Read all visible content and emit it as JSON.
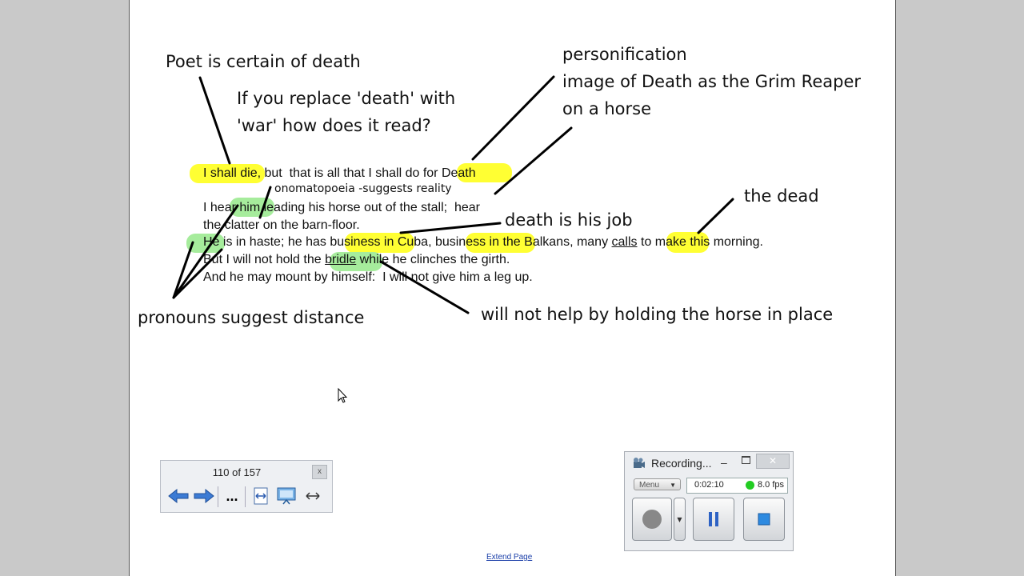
{
  "annotations": {
    "poet_certain": "Poet is certain of death",
    "replace_line1": "If you replace 'death' with",
    "replace_line2": "'war' how does it read?",
    "personification": "personification",
    "grim_line1": "image of Death as the Grim Reaper",
    "grim_line2": "on a horse",
    "onomatopoeia": "onomatopoeia -suggests reality",
    "the_dead": "the dead",
    "death_job": "death is his job",
    "pronouns": "pronouns suggest distance",
    "not_help": "will not help by holding the horse in place"
  },
  "poem": {
    "l1_a": "I shall die",
    "l1_b": ", but  that is all that I shall do fo",
    "l1_c": "r Death",
    "l2_a": "I hear ",
    "l2_b": "him",
    "l2_c": " leading his horse out of the stall;  hear",
    "l3": "the clatter on the barn-floor.",
    "l4_a": "He",
    "l4_b": " is in haste; he has ",
    "l4_c": "business",
    "l4_d": " in Cuba",
    "l4_e": ", business",
    "l4_f": " in the Balkans, many ",
    "l4_g": "calls",
    "l4_h": " to make this morning.",
    "l5_a": "But I will not hold the ",
    "l5_b": "bridle",
    "l5_c": " while he clinches the girth.",
    "l6": "And he may mount by himself:  I will not give him a leg up."
  },
  "navigator": {
    "page_count": "110 of 157",
    "close_label": "x",
    "more_label": "..."
  },
  "recorder": {
    "title": "Recording...",
    "menu_label": "Menu",
    "elapsed": "0:02:10",
    "fps": "8.0 fps",
    "status_color": "#22cc22"
  },
  "footer": {
    "extend_link": "Extend Page"
  },
  "colors": {
    "yellow_highlight": "#ffff33",
    "green_highlight": "#a6ec9c"
  },
  "icons": [
    "back-arrow-icon",
    "forward-arrow-icon",
    "fit-width-icon",
    "presentation-icon",
    "expand-icon",
    "recorder-app-icon",
    "record-icon",
    "pause-icon",
    "stop-icon",
    "mouse-cursor-icon"
  ]
}
